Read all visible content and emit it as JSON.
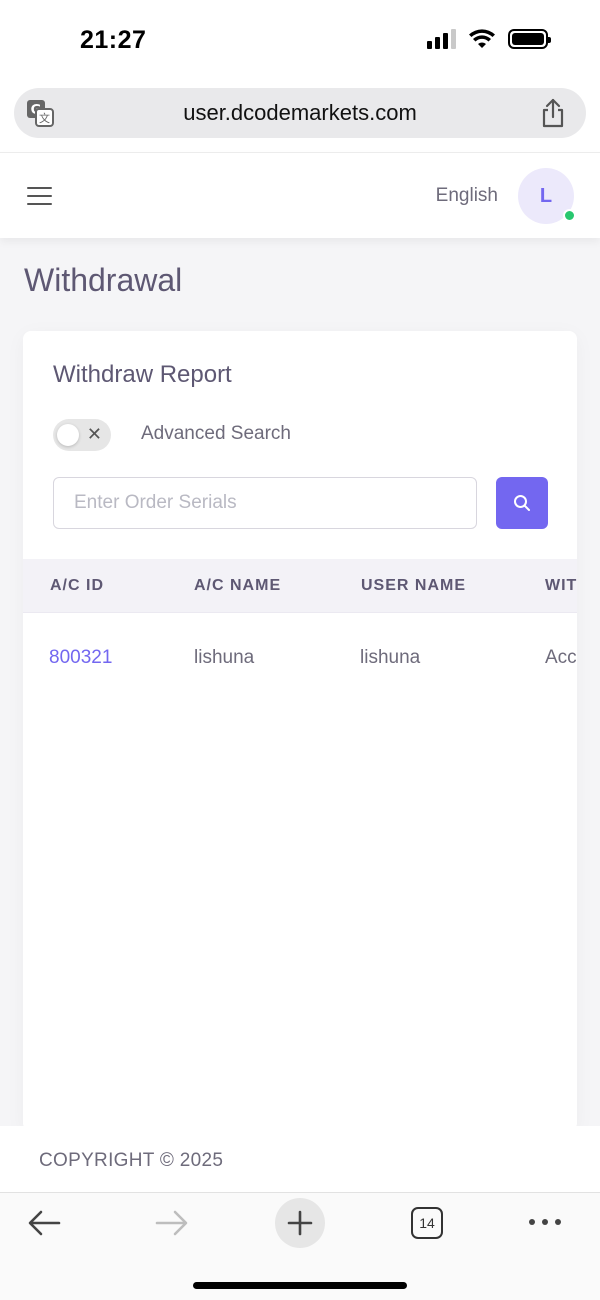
{
  "status_bar": {
    "time": "21:27"
  },
  "browser": {
    "url": "user.dcodemarkets.com",
    "tab_count": "14"
  },
  "topnav": {
    "language": "English",
    "avatar_initial": "L"
  },
  "page": {
    "title": "Withdrawal"
  },
  "card": {
    "title": "Withdraw Report",
    "advanced_search_label": "Advanced Search",
    "search_placeholder": "Enter Order Serials"
  },
  "table": {
    "headers": [
      "A/C ID",
      "A/C NAME",
      "USER NAME",
      "WIT"
    ],
    "rows": [
      {
        "ac_id": "800321",
        "ac_name": "lishuna",
        "user_name": "lishuna",
        "withdraw_col": "Acc"
      }
    ]
  },
  "footer": {
    "copyright": "COPYRIGHT © 2025"
  },
  "colors": {
    "accent": "#7367f0",
    "online": "#28c76f"
  }
}
